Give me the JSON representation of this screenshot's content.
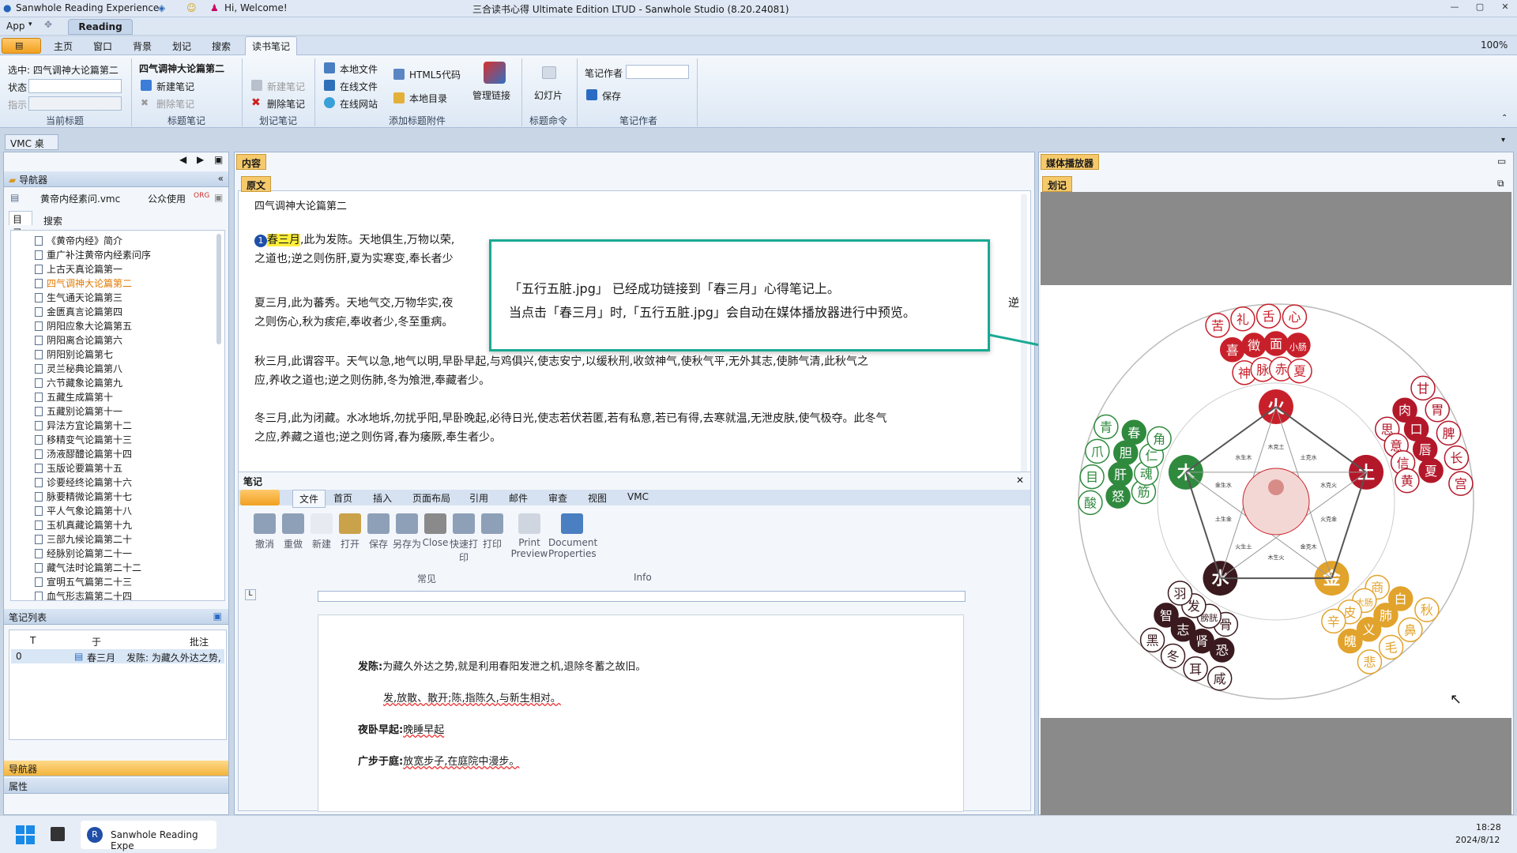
{
  "window": {
    "app_title": "Sanwhole Reading Experience",
    "greeting": "Hi, Welcome!",
    "title": "三合读书心得 Ultimate Edition LTUD - Sanwhole Studio (8.20.24081)"
  },
  "menu": {
    "app": "App",
    "reading_tab": "Reading"
  },
  "ribbon_tabs": [
    "主页",
    "窗口",
    "背景",
    "划记",
    "搜索",
    "读书笔记"
  ],
  "zoom": "100%",
  "ribbon": {
    "selected_label": "选中: 四气调神大论篇第二",
    "status_label": "状态",
    "indicator_label": "指示",
    "current_title_group": "当前标题",
    "note_title": "四气调神大论篇第二",
    "new_note": "新建笔记",
    "delete_note": "删除笔记",
    "title_notes_group": "标题笔记",
    "mark_new_note": "新建笔记",
    "mark_delete_note": "删除笔记",
    "mark_notes_group": "划记笔记",
    "local_file": "本地文件",
    "online_file": "在线文件",
    "online_site": "在线网站",
    "html5_code": "HTML5代码",
    "local_catalog": "本地目录",
    "manage_links": "管理链接",
    "attach_group": "添加标题附件",
    "slideshow": "幻灯片",
    "title_cmd_group": "标题命令",
    "author_label": "笔记作者",
    "save": "保存",
    "author_group": "笔记作者"
  },
  "vmc_tab": "VMC 桌面",
  "navigator": {
    "header": "导航器",
    "file_name": "黄帝内经素问.vmc",
    "public_use": "公众使用",
    "tabs": [
      "目录",
      "搜索"
    ],
    "items": [
      "《黄帝内经》简介",
      "重广补注黄帝内经素问序",
      "上古天真论篇第一",
      "四气调神大论篇第二",
      "生气通天论篇第三",
      "金匮真言论篇第四",
      "阴阳应象大论篇第五",
      "阴阳离合论篇第六",
      "阴阳别论篇第七",
      "灵兰秘典论篇第八",
      "六节藏象论篇第九",
      "五藏生成篇第十",
      "五藏别论篇第十一",
      "异法方宜论篇第十二",
      "移精变气论篇第十三",
      "汤液醪醴论篇第十四",
      "玉版论要篇第十五",
      "诊要经终论篇第十六",
      "脉要精微论篇第十七",
      "平人气象论篇第十八",
      "玉机真藏论篇第十九",
      "三部九候论篇第二十",
      "经脉别论篇第二十一",
      "藏气法时论篇第二十二",
      "宣明五气篇第二十三",
      "血气形志篇第二十四"
    ],
    "selected_index": 3
  },
  "notes_list": {
    "header": "笔记列表",
    "columns": [
      "T",
      "于",
      "批注"
    ],
    "rows": [
      {
        "index": "0",
        "at": "春三月",
        "annotation": "发陈: 为藏久外达之势,"
      }
    ]
  },
  "bottom_nav": {
    "navigator": "导航器",
    "properties": "属性"
  },
  "content": {
    "header": "内容",
    "source_tab": "原文",
    "chapter_title": "四气调神大论篇第二",
    "para1_highlight": "春三月",
    "para1_a": ",此为发陈。天地俱生,万物以荣,",
    "para1_b": "之道也;逆之则伤肝,夏为实寒变,奉长者少",
    "para2_a": "夏三月,此为蕃秀。天地气交,万物华实,夜",
    "para2_b": "之则伤心,秋为痎疟,奉收者少,冬至重病。",
    "para2_c": "逆",
    "para3_a": "秋三月,此谓容平。天气以急,地气以明,早卧早起,与鸡俱兴,使志安宁,以缓秋刑,收敛神气,使秋气平,无外其志,使肺气清,此秋气之",
    "para3_b": "应,养收之道也;逆之则伤肺,冬为飧泄,奉藏者少。",
    "para4_a": "冬三月,此为闭藏。水冰地坼,勿扰乎阳,早卧晚起,必待日光,使志若伏若匿,若有私意,若已有得,去寒就温,无泄皮肤,使气极夺。此冬气",
    "para4_b": "之应,养藏之道也;逆之则伤肾,春为痿厥,奉生者少。"
  },
  "callout": {
    "line1": "「五行五脏.jpg」 已经成功链接到「春三月」心得笔记上。",
    "line2": "当点击「春三月」时,「五行五脏.jpg」会自动在媒体播放器进行中预览。"
  },
  "notes_editor": {
    "header": "笔记",
    "tabs": [
      "文件",
      "首页",
      "插入",
      "页面布局",
      "引用",
      "邮件",
      "审查",
      "视图",
      "VMC"
    ],
    "tools": [
      "撤消",
      "重做",
      "新建",
      "打开",
      "保存",
      "另存为",
      "Close",
      "快速打印",
      "打印",
      "Print Preview",
      "Document Properties"
    ],
    "group_common": "常见",
    "group_info": "Info",
    "line1_bold": "发陈:",
    "line1_rest": "为藏久外达之势,就是利用春阳发泄之机,退除冬蓄之故旧。",
    "line2": "发,放散、散开;陈,指陈久,与新生相对。",
    "line3_bold": "夜卧早起:",
    "line3_rest": "晚睡早起",
    "line4_bold": "广步于庭:",
    "line4_rest": "放宽步子,在庭院中漫步。"
  },
  "media": {
    "header": "媒体播放器",
    "sub_tab": "划记",
    "outer_ring": [
      "苦",
      "喜",
      "神",
      "礼",
      "徵",
      "脉",
      "舌",
      "面",
      "赤",
      "心",
      "小肠",
      "夏",
      "火"
    ],
    "earth": [
      "甘",
      "肉",
      "思",
      "胃",
      "口",
      "意",
      "脾",
      "唇",
      "信",
      "长",
      "夏",
      "黄",
      "宫",
      "土"
    ],
    "wood": [
      "酸",
      "怒",
      "筋",
      "目",
      "肝",
      "魂",
      "爪",
      "胆",
      "仁",
      "青",
      "春",
      "角",
      "木"
    ],
    "water": [
      "咸",
      "恐",
      "骨",
      "耳",
      "肾",
      "膀胱",
      "冬",
      "志",
      "发",
      "黑",
      "智",
      "羽",
      "水"
    ],
    "metal": [
      "秋",
      "白",
      "商",
      "鼻",
      "肺",
      "大肠",
      "毛",
      "义",
      "皮",
      "悲",
      "魄",
      "辛",
      "金"
    ],
    "inner": [
      "木克土",
      "土克水",
      "水克火",
      "火克金",
      "金克木",
      "木生火",
      "火生土",
      "土生金",
      "金生水",
      "水生木"
    ]
  },
  "taskbar": {
    "app": "Sanwhole Reading Expe",
    "time": "18:28",
    "date": "2024/8/12"
  },
  "colors": {
    "accent": "#1aa993",
    "fire": "#c8202a",
    "wood": "#2f8a3e",
    "water": "#3a1a1e",
    "metal": "#e2a32c",
    "highlight": "#ffef3a"
  }
}
